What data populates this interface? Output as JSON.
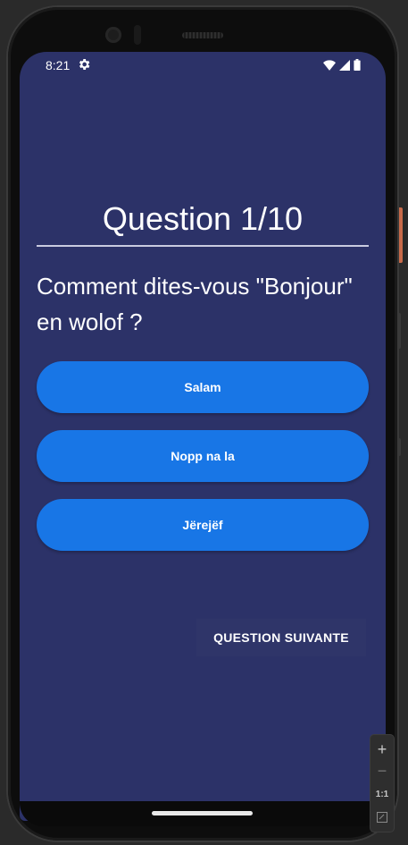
{
  "status_bar": {
    "time": "8:21"
  },
  "quiz": {
    "title": "Question 1/10",
    "question": "Comment dites-vous \"Bonjour\" en wolof ?",
    "answers": [
      "Salam",
      "Nopp na la",
      "Jërejëf"
    ],
    "next_label": "QUESTION SUIVANTE"
  },
  "zoom_toolbar": {
    "zoom_in": "+",
    "zoom_out": "−",
    "actual_size": "1:1"
  },
  "colors": {
    "background": "#2c3268",
    "answer_button": "#1876e6",
    "text": "#ffffff"
  },
  "icons": [
    "gear-icon",
    "wifi-icon",
    "signal-icon",
    "battery-icon",
    "fit-screen-icon"
  ]
}
